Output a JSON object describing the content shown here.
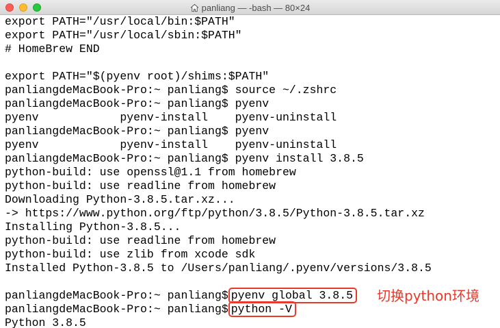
{
  "window": {
    "title": "panliang — -bash — 80×24",
    "icon": "home-icon"
  },
  "terminal": {
    "lines": [
      "export PATH=\"/usr/local/bin:$PATH\"",
      "export PATH=\"/usr/local/sbin:$PATH\"",
      "# HomeBrew END",
      "",
      "export PATH=\"$(pyenv root)/shims:$PATH\"",
      "panliangdeMacBook-Pro:~ panliang$ source ~/.zshrc",
      "panliangdeMacBook-Pro:~ panliang$ pyenv",
      "pyenv            pyenv-install    pyenv-uninstall",
      "panliangdeMacBook-Pro:~ panliang$ pyenv",
      "pyenv            pyenv-install    pyenv-uninstall",
      "panliangdeMacBook-Pro:~ panliang$ pyenv install 3.8.5",
      "python-build: use openssl@1.1 from homebrew",
      "python-build: use readline from homebrew",
      "Downloading Python-3.8.5.tar.xz...",
      "-> https://www.python.org/ftp/python/3.8.5/Python-3.8.5.tar.xz",
      "Installing Python-3.8.5...",
      "python-build: use readline from homebrew",
      "python-build: use zlib from xcode sdk",
      "Installed Python-3.8.5 to /Users/panliang/.pyenv/versions/3.8.5",
      ""
    ],
    "global_prompt": "panliangdeMacBook-Pro:~ panliang$",
    "global_command": "pyenv global 3.8.5",
    "version_prompt": "panliangdeMacBook-Pro:~ panliang$",
    "version_command": "python -V",
    "output": "Python 3.8.5"
  },
  "annotation": {
    "text": "切换python环境",
    "color": "#e8392a"
  },
  "colors": {
    "traffic_close": "#fe5f57",
    "traffic_minimize": "#febc2e",
    "traffic_maximize": "#28c840"
  }
}
